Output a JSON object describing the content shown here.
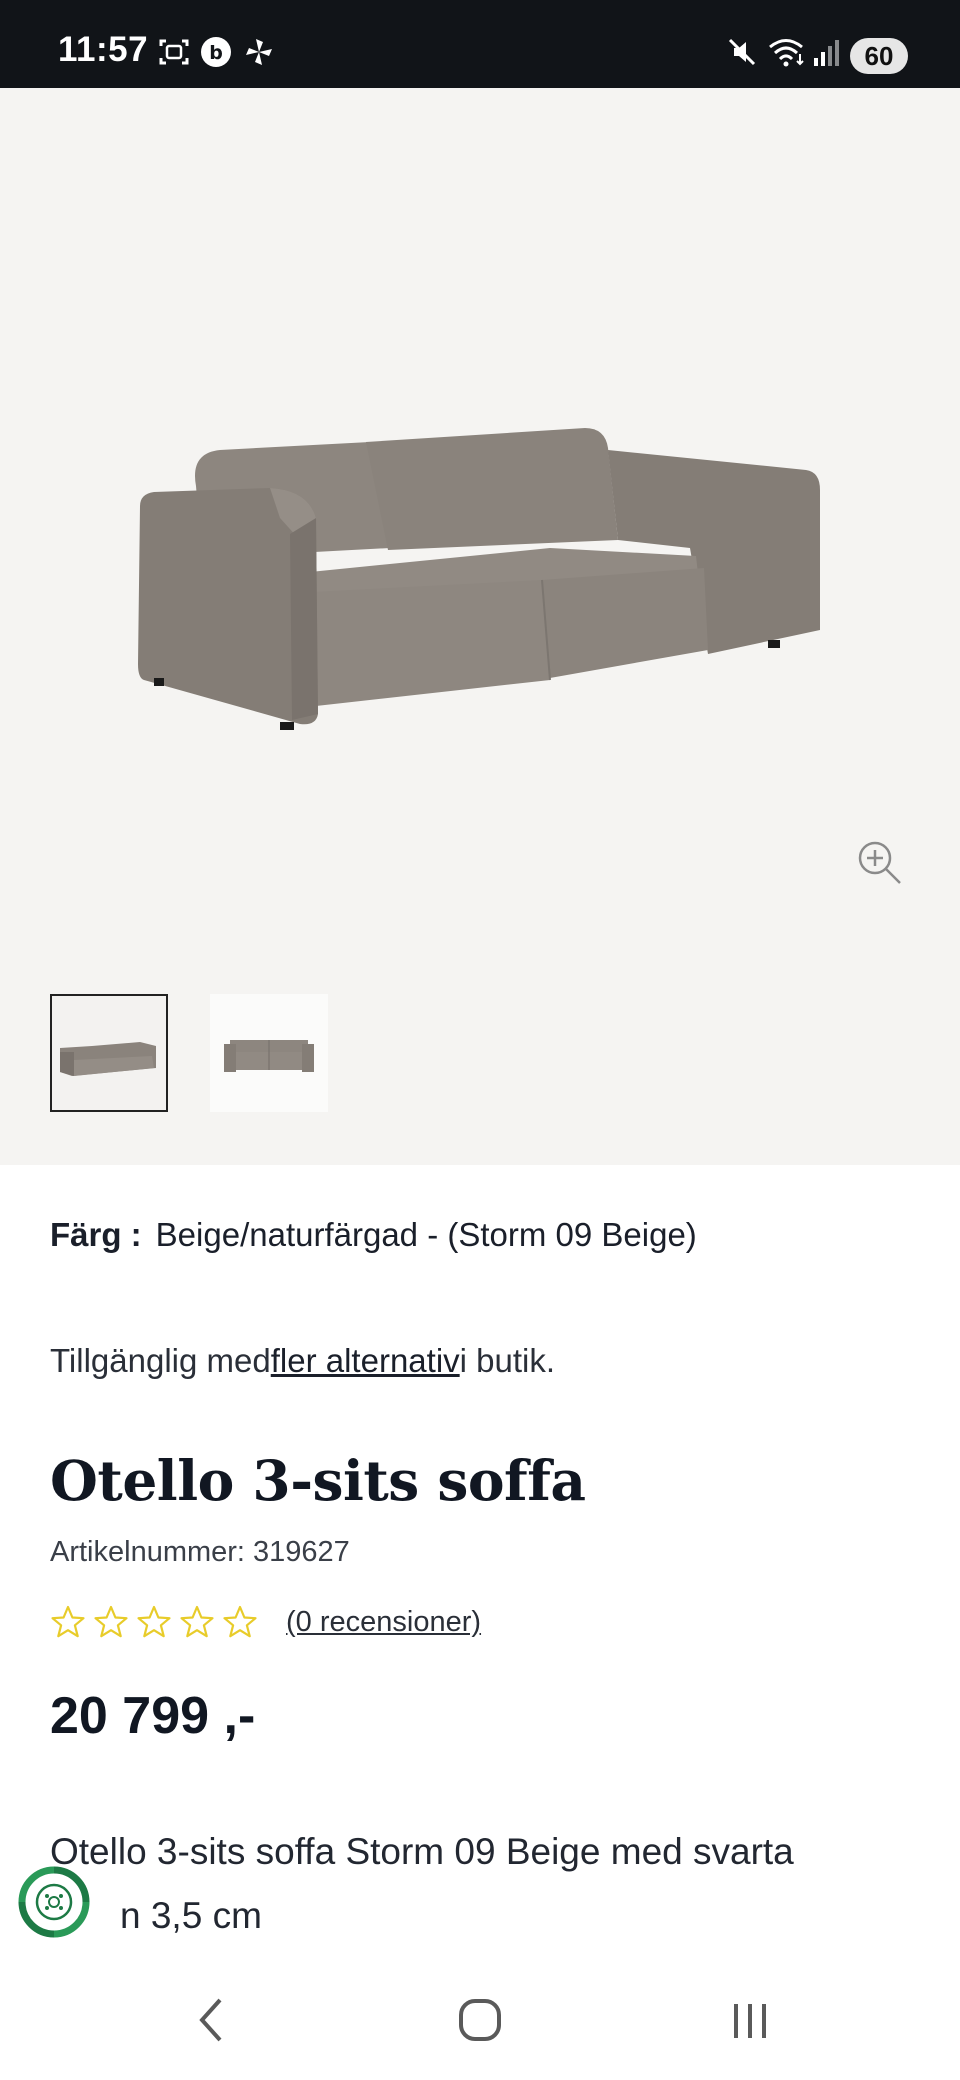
{
  "status_bar": {
    "time": "11:57",
    "icons": [
      "screenshot-icon",
      "b-app-icon",
      "pinwheel-icon",
      "mute-icon",
      "wifi-icon",
      "signal-icon"
    ],
    "battery": "60"
  },
  "gallery": {
    "hero_alt": "Otello 3-sits soffa",
    "zoom_icon": "zoom-in-icon",
    "thumbnails": [
      {
        "active": true
      },
      {
        "active": false
      }
    ],
    "sofa_color": "#8c857e"
  },
  "product": {
    "color_label": "Färg :",
    "color_value": "Beige/naturfärgad - (Storm 09 Beige)",
    "availability_prefix": "Tillgänglig med",
    "availability_link": "fler alternativ",
    "availability_suffix": "i butik.",
    "title": "Otello 3-sits soffa",
    "sku": "Artikelnummer: 319627",
    "rating": 0,
    "max_rating": 5,
    "reviews_link": "(0 recensioner)",
    "price": "20 799 ,-",
    "description_line1": "Otello 3-sits soffa Storm 09 Beige med svarta",
    "description_line2": "n 3,5 cm"
  },
  "colors": {
    "star": "#e8cc2a",
    "eco_green": "#1d7a45",
    "status_bg": "#111418"
  },
  "nav": {
    "back_icon": "back-icon",
    "home_icon": "home-icon",
    "recents_icon": "recents-icon"
  }
}
